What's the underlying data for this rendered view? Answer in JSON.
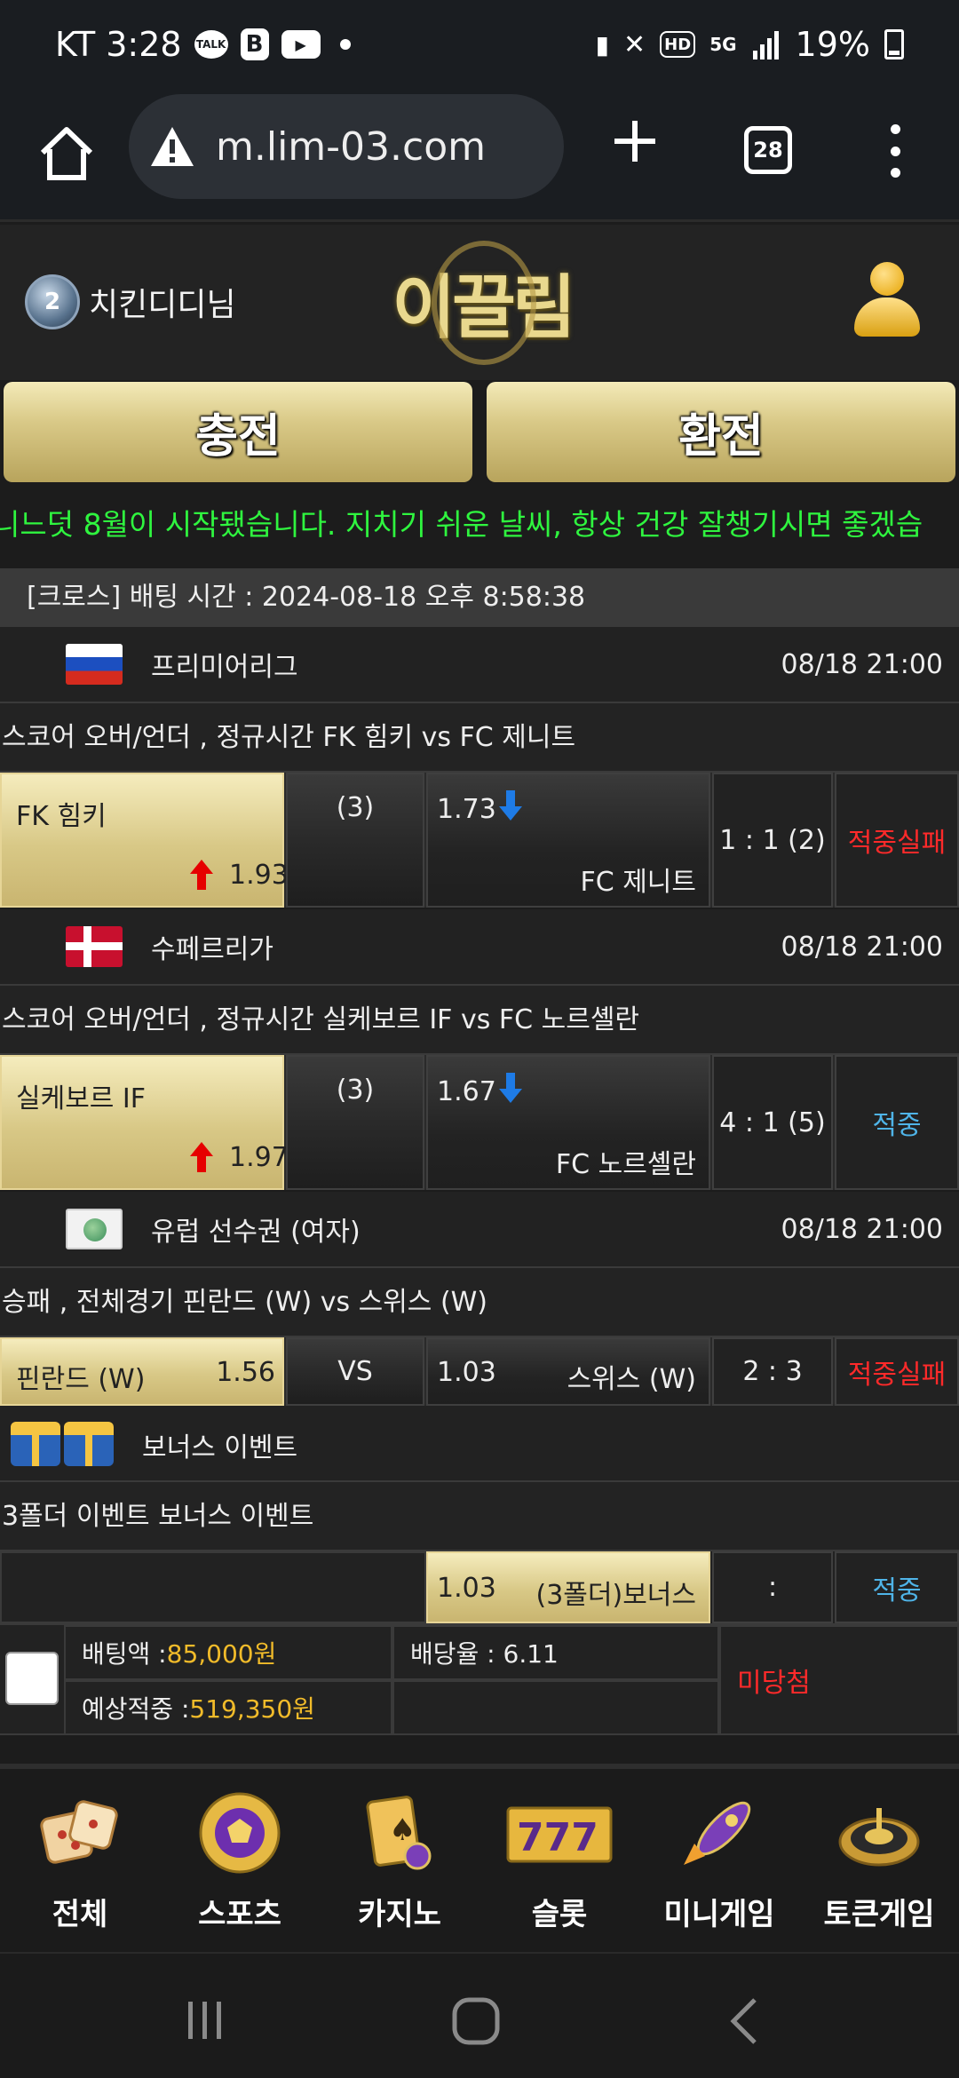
{
  "status_bar": {
    "carrier_time": "KT 3:28",
    "talk_label": "TALK",
    "b_label": "B",
    "battery": "19%",
    "hd_label": "HD",
    "net_label": "5G"
  },
  "browser": {
    "url": "m.lim-03.com",
    "tab_count": "28"
  },
  "header": {
    "rank_level": "2",
    "username": "치킨디디님",
    "logo_text": "이끌림",
    "charge_label": "충전",
    "exchange_label": "환전"
  },
  "marquee": "니느덧 8월이 시작됐습니다. 지치기 쉬운 날씨, 항상 건강 잘챙기시면 좋겠습",
  "bet": {
    "header": "[크로스] 배팅 시간 : 2024-08-18 오후 8:58:38",
    "games": [
      {
        "league": "프리미어리그",
        "date": "08/18 21:00",
        "market": "스코어 오버/언더 , 정규시간 FK 힘키  vs  FC 제니트",
        "home": "FK 힘키",
        "home_odd": "1.93",
        "mid": "(3)",
        "away_odd": "1.73",
        "away": "FC 제니트",
        "score": "1 : 1 (2)",
        "result": "적중실패"
      },
      {
        "league": "수페르리가",
        "date": "08/18 21:00",
        "market": "스코어 오버/언더 , 정규시간 실케보르 IF  vs  FC 노르셸란",
        "home": "실케보르 IF",
        "home_odd": "1.97",
        "mid": "(3)",
        "away_odd": "1.67",
        "away": "FC 노르셸란",
        "score": "4 : 1 (5)",
        "result": "적중"
      },
      {
        "league": "유럽 선수권 (여자)",
        "date": "08/18 21:00",
        "market": "승패 , 전체경기 핀란드 (W)  vs  스위스 (W)",
        "home": "핀란드 (W)",
        "home_odd": "1.56",
        "mid": "VS",
        "away_odd": "1.03",
        "away": "스위스 (W)",
        "score": "2 : 3",
        "result": "적중실패"
      }
    ],
    "bonus": {
      "title": "보너스 이벤트",
      "market": "3폴더 이벤트 보너스 이벤트",
      "odd": "1.03",
      "name": "(3폴더)보너스",
      "score": ":",
      "result": "적중"
    },
    "summary": {
      "bet_amount_label": "배팅액 : ",
      "bet_amount": "85,000원",
      "odds_label": "배당율 : 6.11",
      "expected_label": "예상적중 : ",
      "expected": "519,350원",
      "status": "미당첨"
    }
  },
  "nav": [
    {
      "label": "전체",
      "icon": "dice-icon"
    },
    {
      "label": "스포츠",
      "icon": "soccer-ball-icon"
    },
    {
      "label": "카지노",
      "icon": "cards-icon"
    },
    {
      "label": "슬롯",
      "icon": "slot-777-icon"
    },
    {
      "label": "미니게임",
      "icon": "rocket-icon"
    },
    {
      "label": "토큰게임",
      "icon": "roulette-icon"
    }
  ],
  "colors": {
    "gold": "#d9c987",
    "fail": "#ff2a2a",
    "win": "#4fb4e8",
    "marquee": "#2ff53f",
    "amount": "#f1bb2a"
  }
}
